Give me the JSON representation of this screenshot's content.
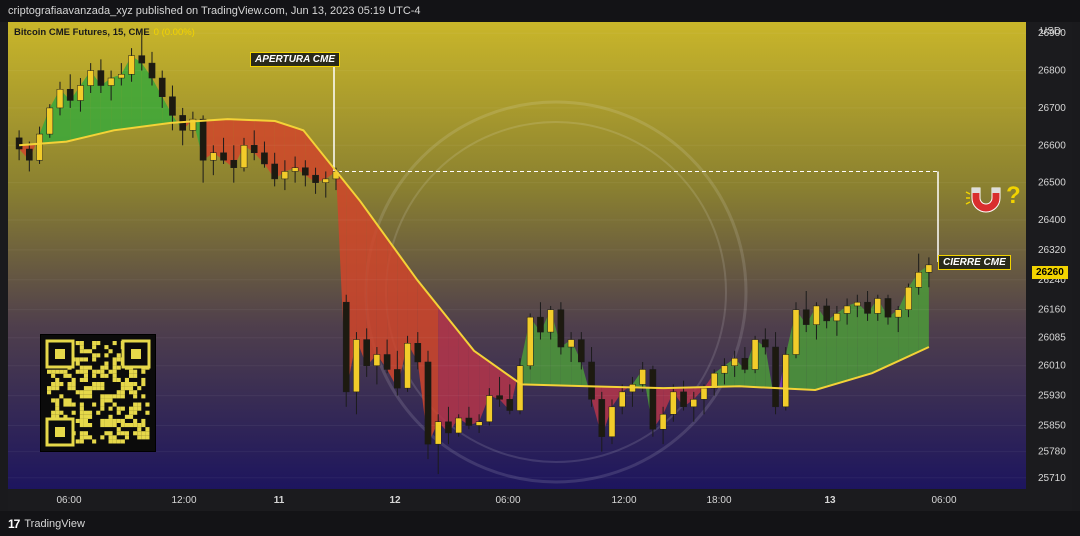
{
  "header": {
    "published_text": "criptografiaavanzada_xyz published on TradingView.com, Jun 13, 2023 05:19 UTC-4"
  },
  "legend": {
    "symbol": "Bitcoin CME Futures, 15, CME",
    "change": "0 (0.00%)"
  },
  "annotations": {
    "open_label": "APERTURA CME",
    "close_label": "CIERRE CME",
    "question_mark": "?"
  },
  "price_tag": "26260",
  "footer": {
    "brand": "TradingView",
    "logo_text": "17"
  },
  "colors": {
    "background_top": "#c6b42a",
    "background_bottom": "#1d155e",
    "ma_line": "#f4d237",
    "candle": "#f2cc2a",
    "wick": "#1b1b1b",
    "cloud_green": "#3aa83a",
    "cloud_red": "#d2452a",
    "cloud_purple": "#7a3ab8"
  },
  "icons": [
    "magnet-icon",
    "question-icon",
    "qr-code-icon",
    "tradingview-logo-icon"
  ],
  "chart_data": {
    "type": "candlestick",
    "symbol": "Bitcoin CME Futures, 15, CME",
    "currency": "USD",
    "ylim": [
      25680,
      26930
    ],
    "y_ticks": [
      26900,
      26800,
      26700,
      26600,
      26500,
      26400,
      26320,
      26240,
      26160,
      26085,
      26010,
      25930,
      25850,
      25780,
      25710
    ],
    "x_ticks": [
      "06:00",
      "12:00",
      "11",
      "12",
      "06:00",
      "12:00",
      "18:00",
      "13",
      "06:00"
    ],
    "last_price": 26260,
    "reference_level": 26530,
    "moving_average_points": [
      {
        "t": 0,
        "v": 26600
      },
      {
        "t": 5,
        "v": 26610
      },
      {
        "t": 10,
        "v": 26640
      },
      {
        "t": 16,
        "v": 26660
      },
      {
        "t": 22,
        "v": 26670
      },
      {
        "t": 27,
        "v": 26665
      },
      {
        "t": 30,
        "v": 26640
      },
      {
        "t": 36,
        "v": 26450
      },
      {
        "t": 42,
        "v": 26240
      },
      {
        "t": 48,
        "v": 26050
      },
      {
        "t": 53,
        "v": 25960
      },
      {
        "t": 60,
        "v": 25955
      },
      {
        "t": 68,
        "v": 25950
      },
      {
        "t": 76,
        "v": 25955
      },
      {
        "t": 84,
        "v": 25945
      },
      {
        "t": 90,
        "v": 25990
      },
      {
        "t": 96,
        "v": 26060
      }
    ],
    "ohlc": [
      [
        26620,
        26640,
        26560,
        26590
      ],
      [
        26590,
        26610,
        26530,
        26560
      ],
      [
        26560,
        26650,
        26550,
        26630
      ],
      [
        26630,
        26710,
        26620,
        26700
      ],
      [
        26700,
        26770,
        26680,
        26750
      ],
      [
        26750,
        26790,
        26700,
        26720
      ],
      [
        26720,
        26780,
        26690,
        26760
      ],
      [
        26760,
        26820,
        26740,
        26800
      ],
      [
        26800,
        26830,
        26740,
        26760
      ],
      [
        26760,
        26800,
        26720,
        26780
      ],
      [
        26780,
        26820,
        26760,
        26790
      ],
      [
        26790,
        26860,
        26770,
        26840
      ],
      [
        26840,
        26910,
        26800,
        26820
      ],
      [
        26820,
        26850,
        26760,
        26780
      ],
      [
        26780,
        26800,
        26700,
        26730
      ],
      [
        26730,
        26760,
        26640,
        26680
      ],
      [
        26680,
        26700,
        26600,
        26640
      ],
      [
        26640,
        26690,
        26620,
        26670
      ],
      [
        26670,
        26680,
        26500,
        26560
      ],
      [
        26560,
        26600,
        26520,
        26580
      ],
      [
        26580,
        26620,
        26550,
        26560
      ],
      [
        26560,
        26600,
        26500,
        26540
      ],
      [
        26540,
        26620,
        26530,
        26600
      ],
      [
        26600,
        26640,
        26560,
        26580
      ],
      [
        26580,
        26610,
        26540,
        26550
      ],
      [
        26550,
        26580,
        26490,
        26510
      ],
      [
        26510,
        26560,
        26480,
        26530
      ],
      [
        26530,
        26570,
        26500,
        26540
      ],
      [
        26540,
        26560,
        26490,
        26520
      ],
      [
        26520,
        26540,
        26470,
        26500
      ],
      [
        26500,
        26530,
        26460,
        26510
      ],
      [
        26510,
        26540,
        26480,
        26530
      ],
      [
        26180,
        26200,
        25900,
        25940
      ],
      [
        25940,
        26100,
        25880,
        26080
      ],
      [
        26080,
        26110,
        25980,
        26010
      ],
      [
        26010,
        26060,
        25960,
        26040
      ],
      [
        26040,
        26080,
        25990,
        26000
      ],
      [
        26000,
        26050,
        25930,
        25950
      ],
      [
        25950,
        26090,
        25940,
        26070
      ],
      [
        26070,
        26100,
        26000,
        26020
      ],
      [
        26020,
        26050,
        25760,
        25800
      ],
      [
        25800,
        25880,
        25720,
        25860
      ],
      [
        25860,
        25900,
        25800,
        25830
      ],
      [
        25830,
        25880,
        25820,
        25870
      ],
      [
        25870,
        25900,
        25840,
        25850
      ],
      [
        25850,
        25880,
        25830,
        25860
      ],
      [
        25860,
        25950,
        25850,
        25930
      ],
      [
        25930,
        25980,
        25900,
        25920
      ],
      [
        25920,
        25960,
        25880,
        25890
      ],
      [
        25890,
        26030,
        25880,
        26010
      ],
      [
        26010,
        26150,
        26000,
        26140
      ],
      [
        26140,
        26180,
        26080,
        26100
      ],
      [
        26100,
        26170,
        26080,
        26160
      ],
      [
        26160,
        26180,
        26040,
        26060
      ],
      [
        26060,
        26100,
        26020,
        26080
      ],
      [
        26080,
        26100,
        26000,
        26020
      ],
      [
        26020,
        26060,
        25900,
        25920
      ],
      [
        25920,
        25940,
        25780,
        25820
      ],
      [
        25820,
        25920,
        25800,
        25900
      ],
      [
        25900,
        25960,
        25880,
        25940
      ],
      [
        25940,
        25980,
        25900,
        25960
      ],
      [
        25960,
        26020,
        25940,
        26000
      ],
      [
        26000,
        26010,
        25820,
        25840
      ],
      [
        25840,
        25900,
        25800,
        25880
      ],
      [
        25880,
        25960,
        25860,
        25940
      ],
      [
        25940,
        25970,
        25890,
        25900
      ],
      [
        25900,
        25940,
        25860,
        25920
      ],
      [
        25920,
        25960,
        25880,
        25950
      ],
      [
        25950,
        26000,
        25930,
        25990
      ],
      [
        25990,
        26030,
        25960,
        26010
      ],
      [
        26010,
        26050,
        25980,
        26030
      ],
      [
        26030,
        26060,
        25990,
        26000
      ],
      [
        26000,
        26090,
        25990,
        26080
      ],
      [
        26080,
        26110,
        26040,
        26060
      ],
      [
        26060,
        26100,
        25880,
        25900
      ],
      [
        25900,
        26060,
        25890,
        26040
      ],
      [
        26040,
        26180,
        26030,
        26160
      ],
      [
        26160,
        26210,
        26100,
        26120
      ],
      [
        26120,
        26180,
        26080,
        26170
      ],
      [
        26170,
        26190,
        26110,
        26130
      ],
      [
        26130,
        26170,
        26090,
        26150
      ],
      [
        26150,
        26190,
        26120,
        26170
      ],
      [
        26170,
        26200,
        26140,
        26180
      ],
      [
        26180,
        26210,
        26130,
        26150
      ],
      [
        26150,
        26200,
        26130,
        26190
      ],
      [
        26190,
        26200,
        26120,
        26140
      ],
      [
        26140,
        26170,
        26100,
        26160
      ],
      [
        26160,
        26230,
        26140,
        26220
      ],
      [
        26220,
        26310,
        26200,
        26260
      ],
      [
        26260,
        26300,
        26220,
        26280
      ]
    ]
  }
}
